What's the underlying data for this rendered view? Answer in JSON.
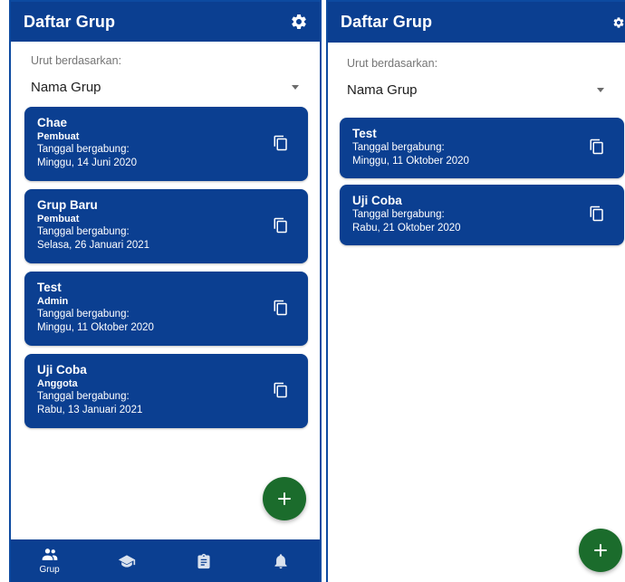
{
  "left": {
    "appbar": {
      "title": "Daftar Grup",
      "settings_icon": "gear-icon"
    },
    "sort": {
      "label": "Urut berdasarkan:",
      "value": "Nama Grup"
    },
    "cards": [
      {
        "name": "Chae",
        "role": "Pembuat",
        "joined_label": "Tanggal bergabung:",
        "joined_date": "Minggu, 14 Juni 2020"
      },
      {
        "name": "Grup Baru",
        "role": "Pembuat",
        "joined_label": "Tanggal bergabung:",
        "joined_date": "Selasa, 26 Januari 2021"
      },
      {
        "name": "Test",
        "role": "Admin",
        "joined_label": "Tanggal bergabung:",
        "joined_date": "Minggu, 11 Oktober 2020"
      },
      {
        "name": "Uji Coba",
        "role": "Anggota",
        "joined_label": "Tanggal bergabung:",
        "joined_date": "Rabu, 13 Januari 2021"
      }
    ],
    "fab_icon": "plus-icon",
    "bottom_nav": [
      {
        "icon": "group-icon",
        "label": "Grup",
        "active": true
      },
      {
        "icon": "graduation-cap-icon",
        "label": "",
        "active": false
      },
      {
        "icon": "clipboard-icon",
        "label": "",
        "active": false
      },
      {
        "icon": "bell-icon",
        "label": "",
        "active": false
      }
    ]
  },
  "right": {
    "appbar": {
      "title": "Daftar Grup",
      "settings_icon": "gear-icon"
    },
    "sort": {
      "label": "Urut berdasarkan:",
      "value": "Nama Grup"
    },
    "cards": [
      {
        "name": "Test",
        "joined_label": "Tanggal bergabung:",
        "joined_date": "Minggu, 11 Oktober 2020"
      },
      {
        "name": "Uji Coba",
        "joined_label": "Tanggal bergabung:",
        "joined_date": "Rabu, 21 Oktober 2020"
      }
    ],
    "fab_icon": "plus-icon"
  },
  "colors": {
    "primary": "#0b3f91",
    "fab": "#1b6c2c",
    "border": "#0d4aa0"
  }
}
